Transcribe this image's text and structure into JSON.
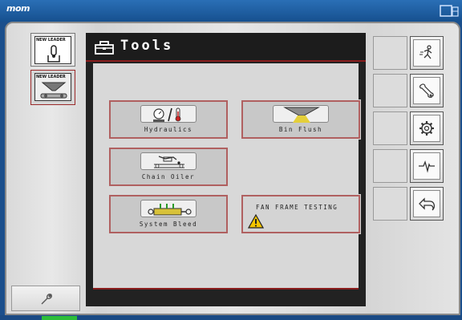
{
  "brand": "mom",
  "panel": {
    "title": "Tools"
  },
  "side_tabs": [
    {
      "tag": "NEW LEADER",
      "icon": "hydraulic-lever-icon"
    },
    {
      "tag": "NEW LEADER",
      "icon": "spreader-hopper-icon"
    }
  ],
  "tools": {
    "hydraulics": {
      "label": "Hydraulics",
      "icon": "hydraulics-pressure-temp-icon"
    },
    "bin_flush": {
      "label": "Bin Flush",
      "icon": "bin-flush-icon"
    },
    "chain_oiler": {
      "label": "Chain Oiler",
      "icon": "chain-oiler-icon"
    },
    "system_bleed": {
      "label": "System Bleed",
      "icon": "system-bleed-icon"
    },
    "fan_frame": {
      "label": "FAN FRAME TESTING",
      "icon": "warning-icon"
    }
  },
  "right_buttons": [
    "run-icon",
    "wrench-icon",
    "gear-icon",
    "waveform-icon",
    "back-arrow-icon"
  ],
  "colors": {
    "accent_red": "#8a1d1d",
    "top_bar": "#1b5fa6",
    "status_green": "#2dbd3a"
  }
}
